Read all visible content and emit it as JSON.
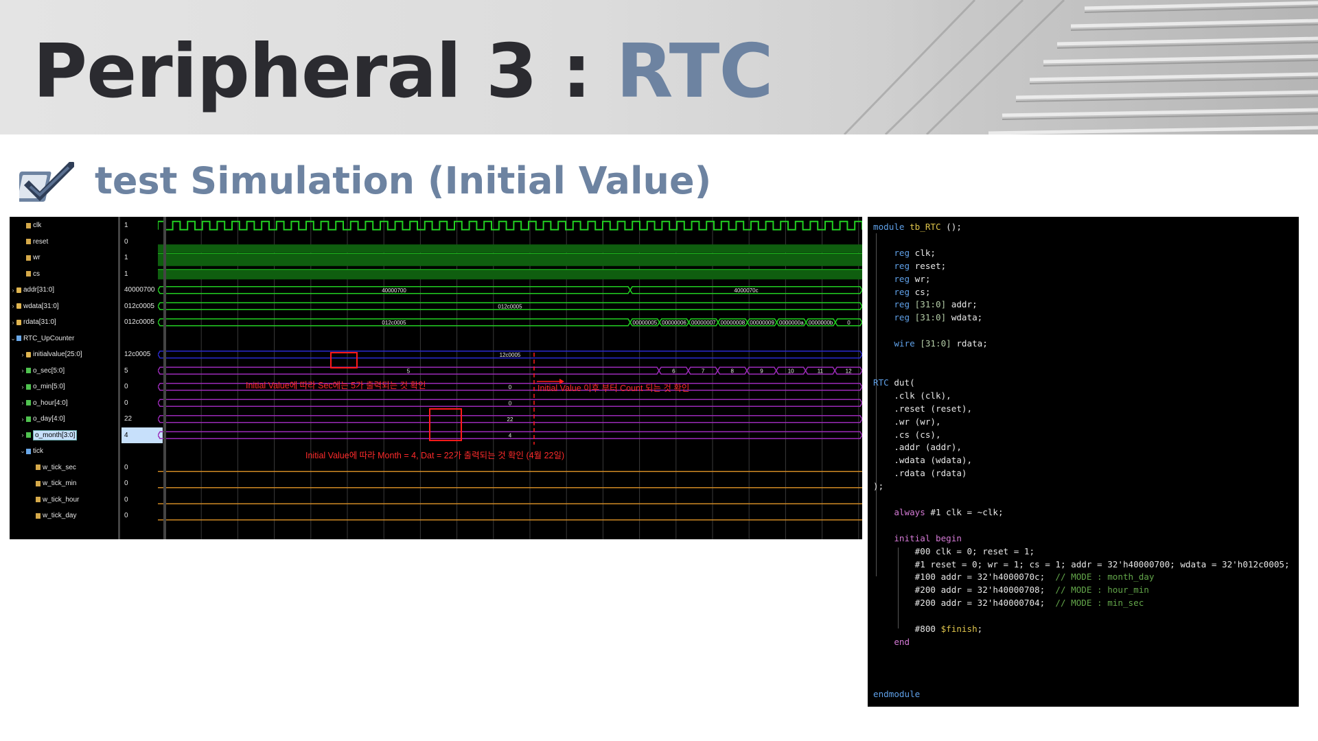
{
  "slide": {
    "title_main": "Peripheral  3 : ",
    "title_accent": "RTC",
    "subtitle": "test Simulation (Initial Value)"
  },
  "colors": {
    "accent": "#6d83a1",
    "title": "#2b2b30",
    "annotation": "#ff2b2b",
    "wave": "#22d022",
    "bus": "#9b2ab8",
    "tick": "#d08a24"
  },
  "signals": [
    {
      "name": "clk",
      "value": "1",
      "kind": "logic",
      "indent": 1
    },
    {
      "name": "reset",
      "value": "0",
      "kind": "logic",
      "indent": 1
    },
    {
      "name": "wr",
      "value": "1",
      "kind": "logic",
      "indent": 1
    },
    {
      "name": "cs",
      "value": "1",
      "kind": "logic",
      "indent": 1
    },
    {
      "name": "addr[31:0]",
      "value": "40000700",
      "kind": "bus",
      "indent": 0
    },
    {
      "name": "wdata[31:0]",
      "value": "012c0005",
      "kind": "bus",
      "indent": 0
    },
    {
      "name": "rdata[31:0]",
      "value": "012c0005",
      "kind": "bus",
      "indent": 0
    },
    {
      "name": "RTC_UpCounter",
      "value": "",
      "kind": "group",
      "indent": 0
    },
    {
      "name": "initialvalue[25:0]",
      "value": "12c0005",
      "kind": "bus",
      "indent": 1
    },
    {
      "name": "o_sec[5:0]",
      "value": "5",
      "kind": "busg",
      "indent": 1
    },
    {
      "name": "o_min[5:0]",
      "value": "0",
      "kind": "busg",
      "indent": 1
    },
    {
      "name": "o_hour[4:0]",
      "value": "0",
      "kind": "busg",
      "indent": 1
    },
    {
      "name": "o_day[4:0]",
      "value": "22",
      "kind": "busg",
      "indent": 1
    },
    {
      "name": "o_month[3:0]",
      "value": "4",
      "kind": "busg",
      "indent": 1,
      "selected": true
    },
    {
      "name": "tick",
      "value": "",
      "kind": "group",
      "indent": 1
    },
    {
      "name": "w_tick_sec",
      "value": "0",
      "kind": "logic",
      "indent": 2
    },
    {
      "name": "w_tick_min",
      "value": "0",
      "kind": "logic",
      "indent": 2
    },
    {
      "name": "w_tick_hour",
      "value": "0",
      "kind": "logic",
      "indent": 2
    },
    {
      "name": "w_tick_day",
      "value": "0",
      "kind": "logic",
      "indent": 2
    }
  ],
  "bus_labels": {
    "addr": [
      "40000700",
      "4000070c"
    ],
    "wdata": [
      "012c0005"
    ],
    "rdata": [
      "012c0005",
      "00000005",
      "00000006",
      "00000007",
      "00000008",
      "00000009",
      "0000000a",
      "0000000b",
      "0"
    ],
    "initialvalue": [
      "12c0005"
    ],
    "o_sec": [
      "5",
      "6",
      "7",
      "8",
      "9",
      "10",
      "11",
      "12"
    ],
    "o_min": [
      "0"
    ],
    "o_hour": [
      "0"
    ],
    "o_day": [
      "22"
    ],
    "o_month": [
      "4"
    ]
  },
  "annotations": {
    "sec": "Initial Value에 따라 Sec에는 5가 출력되는 것 확인",
    "count": "Initial Value 이후 부터 Count 되는 것 확인",
    "month": "Initial Value에 따라 Month = 4, Dat = 22가 출력되는 것 확인 (4월 22일)"
  },
  "code_lines": [
    [
      [
        "module ",
        "kw"
      ],
      [
        "tb_RTC",
        "mod"
      ],
      [
        " ();",
        ""
      ]
    ],
    [],
    [
      [
        "    ",
        ""
      ],
      [
        "reg",
        "kw"
      ],
      [
        " clk;",
        ""
      ]
    ],
    [
      [
        "    ",
        ""
      ],
      [
        "reg",
        "kw"
      ],
      [
        " reset;",
        ""
      ]
    ],
    [
      [
        "    ",
        ""
      ],
      [
        "reg",
        "kw"
      ],
      [
        " wr;",
        ""
      ]
    ],
    [
      [
        "    ",
        ""
      ],
      [
        "reg",
        "kw"
      ],
      [
        " cs;",
        ""
      ]
    ],
    [
      [
        "    ",
        ""
      ],
      [
        "reg",
        "kw"
      ],
      [
        " [31:0]",
        "num"
      ],
      [
        " addr;",
        ""
      ]
    ],
    [
      [
        "    ",
        ""
      ],
      [
        "reg",
        "kw"
      ],
      [
        " [31:0]",
        "num"
      ],
      [
        " wdata;",
        ""
      ]
    ],
    [],
    [
      [
        "    ",
        ""
      ],
      [
        "wire",
        "kw"
      ],
      [
        " [31:0]",
        "num"
      ],
      [
        " rdata;",
        ""
      ]
    ],
    [],
    [],
    [
      [
        "RTC",
        "kw"
      ],
      [
        " dut(",
        ""
      ]
    ],
    [
      [
        "    .clk (clk),",
        ""
      ]
    ],
    [
      [
        "    .reset (reset),",
        ""
      ]
    ],
    [
      [
        "    .wr (wr),",
        ""
      ]
    ],
    [
      [
        "    .cs (cs),",
        ""
      ]
    ],
    [
      [
        "    .addr (addr),",
        ""
      ]
    ],
    [
      [
        "    .wdata (wdata),",
        ""
      ]
    ],
    [
      [
        "    .rdata (rdata)",
        ""
      ]
    ],
    [
      [
        ");",
        ""
      ]
    ],
    [],
    [
      [
        "    ",
        ""
      ],
      [
        "always",
        "kwp"
      ],
      [
        " #1 clk = ~clk;",
        ""
      ]
    ],
    [],
    [
      [
        "    ",
        ""
      ],
      [
        "initial",
        "kwp"
      ],
      [
        " ",
        ""
      ],
      [
        "begin",
        "kwp"
      ]
    ],
    [
      [
        "        #00 clk = 0; reset = 1;",
        ""
      ]
    ],
    [
      [
        "        #1 reset = 0; wr = 1; cs = 1; addr = 32'h40000700; wdata = 32'h012c0005;",
        ""
      ]
    ],
    [
      [
        "        #100 addr = 32'h4000070c;  ",
        ""
      ],
      [
        "// MODE : month_day",
        "cmt"
      ]
    ],
    [
      [
        "        #200 addr = 32'h40000708;  ",
        ""
      ],
      [
        "// MODE : hour_min",
        "cmt"
      ]
    ],
    [
      [
        "        #200 addr = 32'h40000704;  ",
        ""
      ],
      [
        "// MODE : min_sec",
        "cmt"
      ]
    ],
    [],
    [
      [
        "        #800 ",
        ""
      ],
      [
        "$finish",
        "sys"
      ],
      [
        ";",
        ""
      ]
    ],
    [
      [
        "    ",
        ""
      ],
      [
        "end",
        "kwp"
      ]
    ],
    [],
    [],
    [],
    [
      [
        "endmodule",
        "kw"
      ]
    ]
  ]
}
